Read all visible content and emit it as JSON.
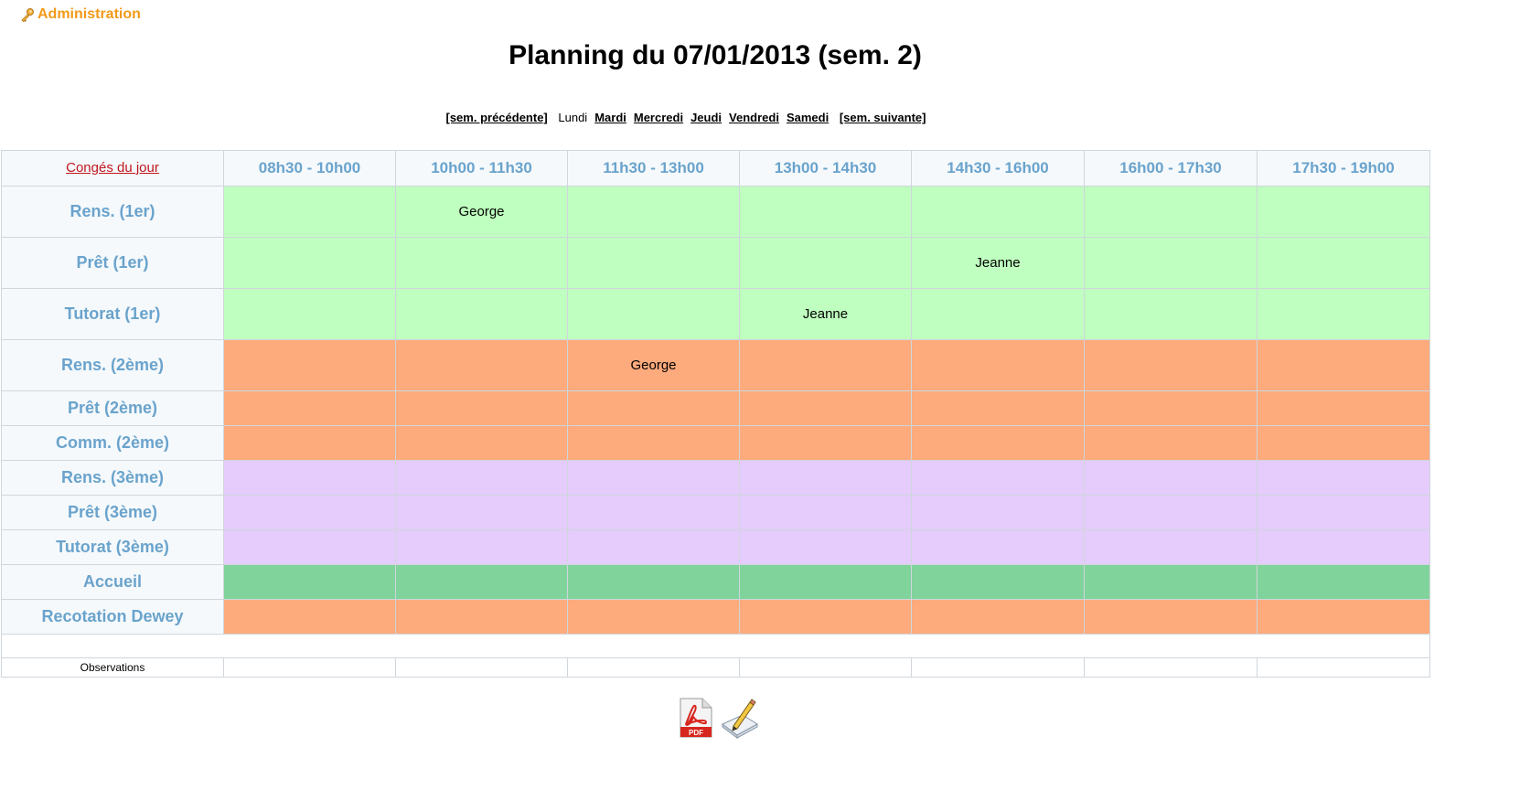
{
  "header": {
    "admin_label": "Administration",
    "title": "Planning du 07/01/2013 (sem. 2)"
  },
  "nav": {
    "prev_week": "[sem. précédente]",
    "days": [
      {
        "label": "Lundi",
        "current": true
      },
      {
        "label": "Mardi",
        "current": false
      },
      {
        "label": "Mercredi",
        "current": false
      },
      {
        "label": "Jeudi",
        "current": false
      },
      {
        "label": "Vendredi",
        "current": false
      },
      {
        "label": "Samedi",
        "current": false
      }
    ],
    "next_week": "[sem. suivante]"
  },
  "table": {
    "conges_label": "Congés du jour",
    "slots": [
      "08h30 - 10h00",
      "10h00 - 11h30",
      "11h30 - 13h00",
      "13h00 - 14h30",
      "14h30 - 16h00",
      "16h00 - 17h30",
      "17h30 - 19h00"
    ],
    "rows": [
      {
        "label": "Rens. (1er)",
        "color": "#bfffbf",
        "cells": [
          "",
          "George",
          "",
          "",
          "",
          "",
          ""
        ]
      },
      {
        "label": "Prêt (1er)",
        "color": "#bfffbf",
        "cells": [
          "",
          "",
          "",
          "",
          "Jeanne",
          "",
          ""
        ]
      },
      {
        "label": "Tutorat (1er)",
        "color": "#bfffbf",
        "cells": [
          "",
          "",
          "",
          "Jeanne",
          "",
          "",
          ""
        ]
      },
      {
        "label": "Rens. (2ème)",
        "color": "#fdaa7c",
        "cells": [
          "",
          "",
          "George",
          "",
          "",
          "",
          ""
        ]
      },
      {
        "label": "Prêt (2ème)",
        "color": "#fdaa7c",
        "cells": [
          "",
          "",
          "",
          "",
          "",
          "",
          ""
        ]
      },
      {
        "label": "Comm. (2ème)",
        "color": "#fdaa7c",
        "cells": [
          "",
          "",
          "",
          "",
          "",
          "",
          ""
        ]
      },
      {
        "label": "Rens. (3ème)",
        "color": "#e5ccfc",
        "cells": [
          "",
          "",
          "",
          "",
          "",
          "",
          ""
        ]
      },
      {
        "label": "Prêt (3ème)",
        "color": "#e5ccfc",
        "cells": [
          "",
          "",
          "",
          "",
          "",
          "",
          ""
        ]
      },
      {
        "label": "Tutorat (3ème)",
        "color": "#e5ccfc",
        "cells": [
          "",
          "",
          "",
          "",
          "",
          "",
          ""
        ]
      },
      {
        "label": "Accueil",
        "color": "#80d39b",
        "cells": [
          "",
          "",
          "",
          "",
          "",
          "",
          ""
        ]
      },
      {
        "label": "Recotation Dewey",
        "color": "#fdaa7c",
        "cells": [
          "",
          "",
          "",
          "",
          "",
          "",
          ""
        ]
      }
    ],
    "observations_label": "Observations"
  },
  "icons": {
    "admin": "key-icon",
    "pdf": "pdf-icon",
    "edit": "edit-icon"
  }
}
